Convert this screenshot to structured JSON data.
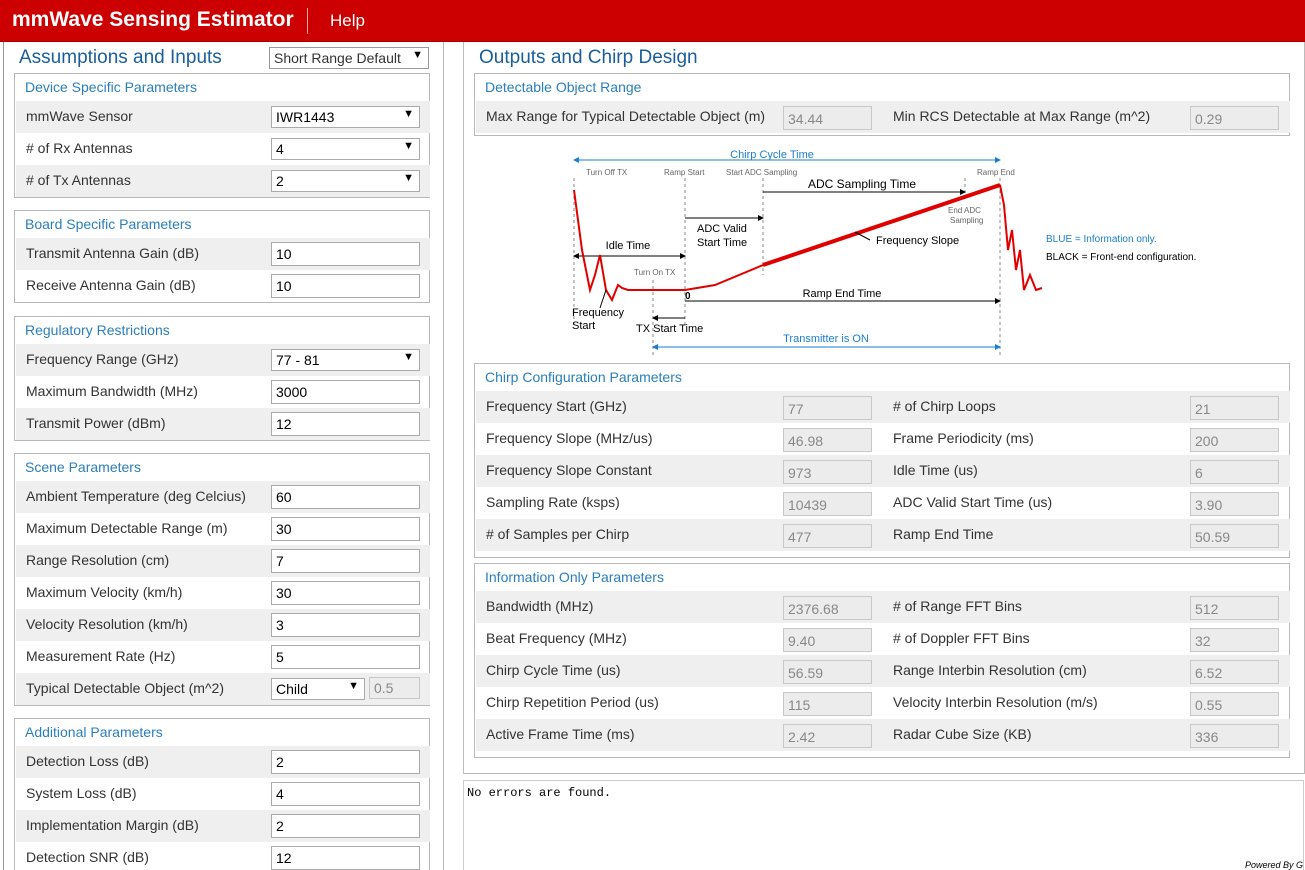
{
  "header": {
    "title": "mmWave Sensing Estimator",
    "help": "Help"
  },
  "left": {
    "title": "Assumptions and Inputs",
    "preset": "Short Range Default",
    "device": {
      "title": "Device Specific Parameters",
      "sensor_label": "mmWave Sensor",
      "sensor_value": "IWR1443",
      "rx_label": "# of Rx Antennas",
      "rx_value": "4",
      "tx_label": "# of Tx Antennas",
      "tx_value": "2"
    },
    "board": {
      "title": "Board Specific Parameters",
      "tx_gain_label": "Transmit Antenna Gain (dB)",
      "tx_gain_value": "10",
      "rx_gain_label": "Receive Antenna Gain (dB)",
      "rx_gain_value": "10"
    },
    "regulatory": {
      "title": "Regulatory Restrictions",
      "freq_label": "Frequency Range (GHz)",
      "freq_value": "77 - 81",
      "bw_label": "Maximum Bandwidth (MHz)",
      "bw_value": "3000",
      "power_label": "Transmit Power (dBm)",
      "power_value": "12"
    },
    "scene": {
      "title": "Scene Parameters",
      "temp_label": "Ambient Temperature (deg Celcius)",
      "temp_value": "60",
      "range_label": "Maximum Detectable Range (m)",
      "range_value": "30",
      "res_label": "Range Resolution (cm)",
      "res_value": "7",
      "vel_label": "Maximum Velocity (km/h)",
      "vel_value": "30",
      "velres_label": "Velocity Resolution (km/h)",
      "velres_value": "3",
      "rate_label": "Measurement Rate (Hz)",
      "rate_value": "5",
      "obj_label": "Typical Detectable Object (m^2)",
      "obj_value": "Child",
      "obj_rcs": "0.5"
    },
    "additional": {
      "title": "Additional Parameters",
      "det_loss_label": "Detection Loss (dB)",
      "det_loss_value": "2",
      "sys_loss_label": "System Loss (dB)",
      "sys_loss_value": "4",
      "impl_label": "Implementation Margin (dB)",
      "impl_value": "2",
      "snr_label": "Detection SNR (dB)",
      "snr_value": "12"
    }
  },
  "right": {
    "title": "Outputs and Chirp Design",
    "range": {
      "title": "Detectable Object Range",
      "max_label": "Max Range for Typical Detectable Object (m)",
      "max_value": "34.44",
      "rcs_label": "Min RCS Detectable at Max Range (m^2)",
      "rcs_value": "0.29"
    },
    "diagram": {
      "chirp_cycle": "Chirp Cycle Time",
      "turn_off_tx": "Turn Off TX",
      "ramp_start": "Ramp Start",
      "start_adc": "Start ADC Sampling",
      "ramp_end_top": "Ramp End",
      "adc_sampling_time": "ADC Sampling Time",
      "end_adc_1": "End ADC",
      "end_adc_2": "Sampling",
      "idle_time": "Idle Time",
      "adc_valid_1": "ADC Valid",
      "adc_valid_2": "Start Time",
      "freq_slope": "Frequency Slope",
      "turn_on_tx": "Turn On TX",
      "zero": "0",
      "ramp_end_time": "Ramp End Time",
      "freq_start_1": "Frequency",
      "freq_start_2": "Start",
      "tx_start_time": "TX Start Time",
      "tx_on": "Transmitter is ON",
      "legend_blue": "BLUE = Information only.",
      "legend_black": "BLACK = Front-end configuration."
    },
    "chirp": {
      "title": "Chirp Configuration Parameters",
      "fstart_label": "Frequency Start (GHz)",
      "fstart_value": "77",
      "loops_label": "# of Chirp Loops",
      "loops_value": "21",
      "slope_label": "Frequency Slope (MHz/us)",
      "slope_value": "46.98",
      "period_label": "Frame Periodicity (ms)",
      "period_value": "200",
      "slope_const_label": "Frequency Slope Constant",
      "slope_const_value": "973",
      "idle_label": "Idle Time (us)",
      "idle_value": "6",
      "srate_label": "Sampling Rate (ksps)",
      "srate_value": "10439",
      "adcvalid_label": "ADC Valid Start Time (us)",
      "adcvalid_value": "3.90",
      "samples_label": "# of Samples per Chirp",
      "samples_value": "477",
      "rampend_label": "Ramp End Time",
      "rampend_value": "50.59"
    },
    "info": {
      "title": "Information Only Parameters",
      "bw_label": "Bandwidth (MHz)",
      "bw_value": "2376.68",
      "rfft_label": "# of Range FFT Bins",
      "rfft_value": "512",
      "beat_label": "Beat Frequency (MHz)",
      "beat_value": "9.40",
      "dfft_label": "# of Doppler FFT Bins",
      "dfft_value": "32",
      "cycle_label": "Chirp Cycle Time (us)",
      "cycle_value": "56.59",
      "rres_label": "Range Interbin Resolution (cm)",
      "rres_value": "6.52",
      "rep_label": "Chirp Repetition Period (us)",
      "rep_value": "115",
      "vres_label": "Velocity Interbin Resolution (m/s)",
      "vres_value": "0.55",
      "active_label": "Active Frame Time (ms)",
      "active_value": "2.42",
      "cube_label": "Radar Cube Size (KB)",
      "cube_value": "336"
    }
  },
  "console": {
    "message": "No errors are found.",
    "powered": "Powered By G"
  },
  "colors": {
    "brand": "#cc0000",
    "heading": "#1a5e9a",
    "group_title": "#2a7fbb",
    "info_blue": "#1a7fd0",
    "ramp": "#e00000"
  }
}
